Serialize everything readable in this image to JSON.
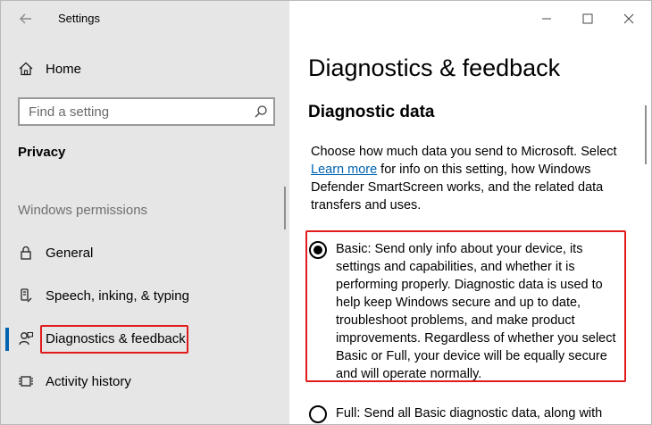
{
  "window": {
    "app_title": "Settings",
    "controls": {
      "minimize_icon": "minimize-icon",
      "maximize_icon": "maximize-icon",
      "close_icon": "close-icon"
    }
  },
  "sidebar": {
    "home_label": "Home",
    "search": {
      "placeholder": "Find a setting",
      "value": ""
    },
    "section_label": "Privacy",
    "group_label": "Windows permissions",
    "items": [
      {
        "label": "General",
        "icon": "lock-icon"
      },
      {
        "label": "Speech, inking, & typing",
        "icon": "speech-icon"
      },
      {
        "label": "Diagnostics & feedback",
        "icon": "feedback-icon",
        "active": true
      },
      {
        "label": "Activity history",
        "icon": "activity-history-icon"
      }
    ]
  },
  "main": {
    "title": "Diagnostics & feedback",
    "subtitle": "Diagnostic data",
    "description_before": "Choose how much data you send to Microsoft. Select",
    "learn_more": "Learn more",
    "description_after": " for info on this setting, how Windows Defender SmartScreen works, and the related data transfers and uses.",
    "options": [
      {
        "label": "Basic: Send only info about your device, its settings and capabilities, and whether it is performing properly. Diagnostic data is used to help keep Windows secure and up to date, troubleshoot problems, and make product improvements. Regardless of whether you select Basic or Full, your device will be equally secure and will operate normally.",
        "selected": true
      },
      {
        "label": "Full: Send all Basic diagnostic data, along with",
        "selected": false
      }
    ]
  },
  "colors": {
    "accent": "#0063b1",
    "highlight": "#e11b1b",
    "sidebar_bg": "#e6e6e6"
  }
}
